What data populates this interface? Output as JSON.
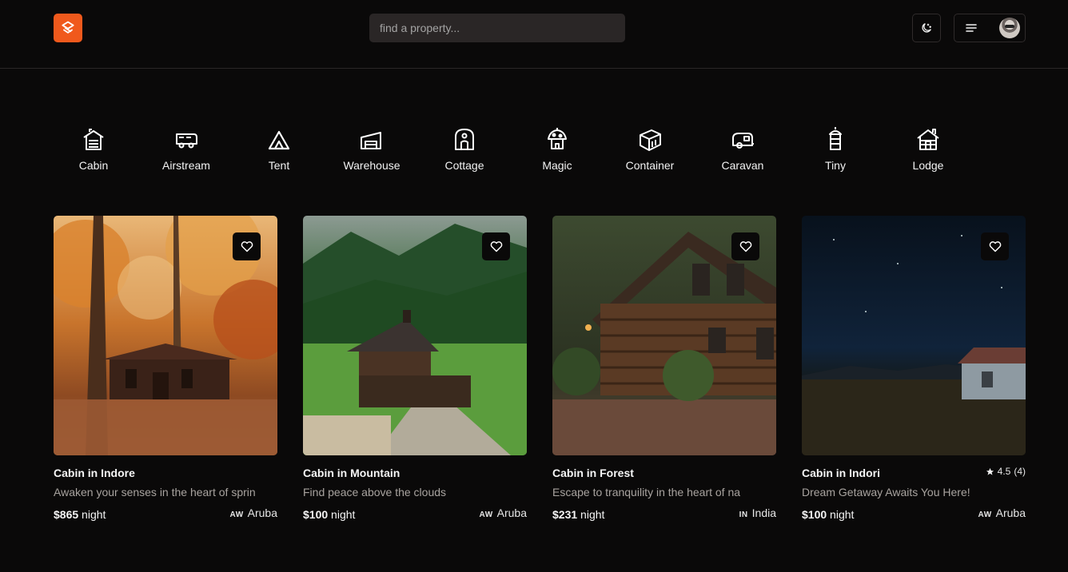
{
  "header": {
    "search_placeholder": "find a property...",
    "accent_color": "#f0591c"
  },
  "categories": [
    {
      "label": "Cabin",
      "icon": "cabin-icon"
    },
    {
      "label": "Airstream",
      "icon": "airstream-icon"
    },
    {
      "label": "Tent",
      "icon": "tent-icon"
    },
    {
      "label": "Warehouse",
      "icon": "warehouse-icon"
    },
    {
      "label": "Cottage",
      "icon": "cottage-icon"
    },
    {
      "label": "Magic",
      "icon": "magic-icon"
    },
    {
      "label": "Container",
      "icon": "container-icon"
    },
    {
      "label": "Caravan",
      "icon": "caravan-icon"
    },
    {
      "label": "Tiny",
      "icon": "tiny-icon"
    },
    {
      "label": "Lodge",
      "icon": "lodge-icon"
    }
  ],
  "listings": [
    {
      "title": "Cabin in Indore",
      "description": "Awaken your senses in the heart of sprin",
      "price": "$865",
      "unit": "night",
      "country_code": "AW",
      "country": "Aruba",
      "rating": "",
      "reviews": ""
    },
    {
      "title": "Cabin in Mountain",
      "description": "Find peace above the clouds",
      "price": "$100",
      "unit": "night",
      "country_code": "AW",
      "country": "Aruba",
      "rating": "",
      "reviews": ""
    },
    {
      "title": "Cabin in Forest",
      "description": "Escape to tranquility in the heart of na",
      "price": "$231",
      "unit": "night",
      "country_code": "IN",
      "country": "India",
      "rating": "",
      "reviews": ""
    },
    {
      "title": "Cabin in Indori",
      "description": "Dream Getaway Awaits You Here!",
      "price": "$100",
      "unit": "night",
      "country_code": "AW",
      "country": "Aruba",
      "rating": "4.5",
      "reviews": "(4)"
    }
  ]
}
